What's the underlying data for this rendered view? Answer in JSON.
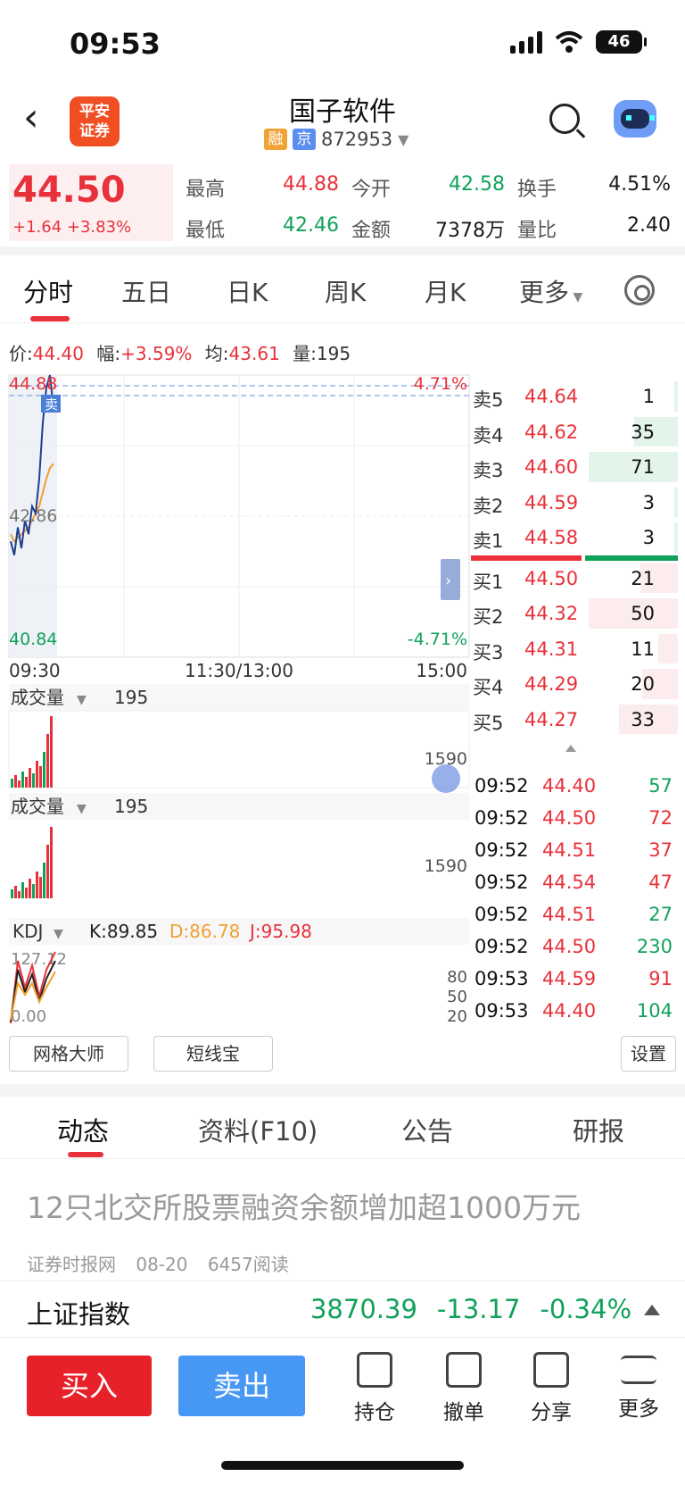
{
  "status": {
    "time": "09:53",
    "battery": "46"
  },
  "header": {
    "title": "国子软件",
    "logo_text": "平安\n证券",
    "tag_rong": "融",
    "tag_jing": "京",
    "code": "872953"
  },
  "quote": {
    "price": "44.50",
    "change": "+1.64 +3.83%",
    "fields": [
      {
        "label": "最高",
        "value": "44.88"
      },
      {
        "label": "今开",
        "value": "42.58"
      },
      {
        "label": "换手",
        "value": "4.51%"
      },
      {
        "label": "最低",
        "value": "42.46"
      },
      {
        "label": "金额",
        "value": "7378万"
      },
      {
        "label": "量比",
        "value": "2.40"
      }
    ]
  },
  "tabs": [
    "分时",
    "五日",
    "日K",
    "周K",
    "月K",
    "更多"
  ],
  "info_line": {
    "price_label": "价:",
    "price": "44.40",
    "amp_label": "幅:",
    "amp": "+3.59%",
    "avg_label": "均:",
    "avg": "43.61",
    "vol_label": "量:",
    "vol": "195"
  },
  "chart_data": {
    "type": "line",
    "y_top": "44.88",
    "y_mid": "42.86",
    "y_bottom": "40.84",
    "pct_top": "4.71%",
    "pct_bottom": "-4.71%",
    "x_labels": [
      "09:30",
      "11:30/13:00",
      "15:00"
    ],
    "sell_marker": "卖",
    "price_series": [
      42.5,
      42.3,
      42.7,
      42.4,
      42.8,
      42.6,
      43.0,
      42.9,
      43.4,
      44.2,
      44.7,
      44.88,
      44.4
    ],
    "avg_series": [
      42.6,
      42.5,
      42.55,
      42.6,
      42.65,
      42.7,
      42.8,
      42.9,
      43.0,
      43.2,
      43.4,
      43.55,
      43.61
    ]
  },
  "volume_panel": {
    "label": "成交量",
    "value": "195",
    "max": "1590"
  },
  "volume_panel2": {
    "label": "成交量",
    "value": "195",
    "max": "1590"
  },
  "kdj": {
    "label": "KDJ",
    "k": "K:89.85",
    "d": "D:86.78",
    "j": "J:95.98",
    "top": "127.12",
    "bottom": "0.00",
    "levels": [
      "80",
      "50",
      "20"
    ]
  },
  "order_book": {
    "asks": [
      {
        "label": "卖5",
        "price": "44.64",
        "vol": "1",
        "fill": 0.02
      },
      {
        "label": "卖4",
        "price": "44.62",
        "vol": "35",
        "fill": 0.49
      },
      {
        "label": "卖3",
        "price": "44.60",
        "vol": "71",
        "fill": 1.0
      },
      {
        "label": "卖2",
        "price": "44.59",
        "vol": "3",
        "fill": 0.04
      },
      {
        "label": "卖1",
        "price": "44.58",
        "vol": "3",
        "fill": 0.04
      }
    ],
    "bids": [
      {
        "label": "买1",
        "price": "44.50",
        "vol": "21",
        "fill": 0.42
      },
      {
        "label": "买2",
        "price": "44.32",
        "vol": "50",
        "fill": 1.0
      },
      {
        "label": "买3",
        "price": "44.31",
        "vol": "11",
        "fill": 0.22
      },
      {
        "label": "买4",
        "price": "44.29",
        "vol": "20",
        "fill": 0.4
      },
      {
        "label": "买5",
        "price": "44.27",
        "vol": "33",
        "fill": 0.66
      }
    ]
  },
  "trades": [
    {
      "time": "09:52",
      "price": "44.40",
      "vol": "57",
      "dir": "down"
    },
    {
      "time": "09:52",
      "price": "44.50",
      "vol": "72",
      "dir": "up"
    },
    {
      "time": "09:52",
      "price": "44.51",
      "vol": "37",
      "dir": "up"
    },
    {
      "time": "09:52",
      "price": "44.54",
      "vol": "47",
      "dir": "up"
    },
    {
      "time": "09:52",
      "price": "44.51",
      "vol": "27",
      "dir": "down"
    },
    {
      "time": "09:52",
      "price": "44.50",
      "vol": "230",
      "dir": "down"
    },
    {
      "time": "09:53",
      "price": "44.59",
      "vol": "91",
      "dir": "up"
    },
    {
      "time": "09:53",
      "price": "44.40",
      "vol": "104",
      "dir": "down"
    }
  ],
  "tools": {
    "grid": "网格大师",
    "short": "短线宝",
    "settings": "设置"
  },
  "news_tabs": [
    "动态",
    "资料(F10)",
    "公告",
    "研报"
  ],
  "news": {
    "title": "12只北交所股票融资余额增加超1000万元",
    "source": "证券时报网",
    "date": "08-20",
    "reads": "6457阅读"
  },
  "index": {
    "name": "上证指数",
    "value": "3870.39",
    "change": "-13.17",
    "pct": "-0.34%"
  },
  "bottom": {
    "buy": "买入",
    "sell": "卖出",
    "items": [
      "持仓",
      "撤单",
      "分享",
      "更多"
    ]
  },
  "colors": {
    "up": "#e8313a",
    "down": "#11a25a",
    "price_line": "#1f3f8f",
    "avg_line": "#f0a030"
  }
}
